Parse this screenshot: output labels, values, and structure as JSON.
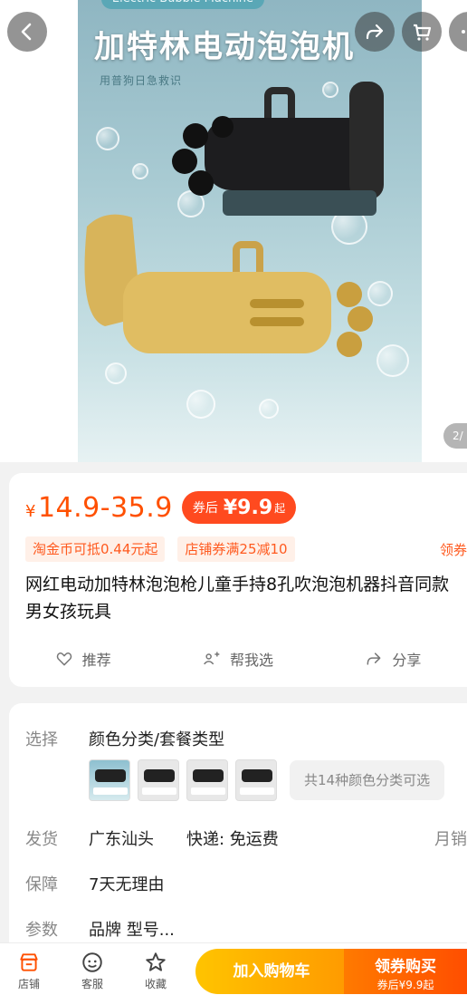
{
  "hero": {
    "badge_text": "Electric Bubble Machine",
    "title": "加特林电动泡泡机",
    "subtitle": "用普狗日急救识",
    "page_indicator": "2/"
  },
  "nav": {
    "back_icon": "chevron-left-icon",
    "share_icon": "share-icon",
    "cart_icon": "cart-icon",
    "more_icon": "more-icon"
  },
  "price": {
    "currency": "¥",
    "range": "14.9-35.9",
    "after_coupon_label": "券后",
    "after_coupon_value": "¥9.9",
    "after_coupon_suffix": "起"
  },
  "promotions": {
    "tags": [
      "淘金币可抵0.44元起",
      "店铺券满25减10"
    ],
    "claim_label": "领券"
  },
  "product": {
    "title": "网红电动加特林泡泡枪儿童手持8孔吹泡泡机器抖音同款男女孩玩具"
  },
  "actions": [
    {
      "label": "推荐",
      "icon": "thumbs-up-icon"
    },
    {
      "label": "帮我选",
      "icon": "help-choose-icon"
    },
    {
      "label": "分享",
      "icon": "share-icon"
    }
  ],
  "specs": {
    "select_label": "选择",
    "select_value": "颜色分类/套餐类型",
    "more_options": "共14种颜色分类可选",
    "ship_label": "发货",
    "ship_from": "广东汕头",
    "ship_method": "快递: 免运费",
    "monthly_label": "月销",
    "guarantee_label": "保障",
    "guarantee_value": "7天无理由",
    "params_label": "参数",
    "params_value": "品牌 型号..."
  },
  "bottom_bar": {
    "tabs": [
      {
        "label": "店铺",
        "icon": "store-icon"
      },
      {
        "label": "客服",
        "icon": "chat-icon"
      },
      {
        "label": "收藏",
        "icon": "star-icon"
      }
    ],
    "add_to_cart": "加入购物车",
    "buy_label": "领券购买",
    "buy_sub": "券后¥9.9起"
  },
  "colors": {
    "accent": "#ff5000",
    "cart_button": "#ffb000",
    "buy_button": "#ff5a00"
  }
}
